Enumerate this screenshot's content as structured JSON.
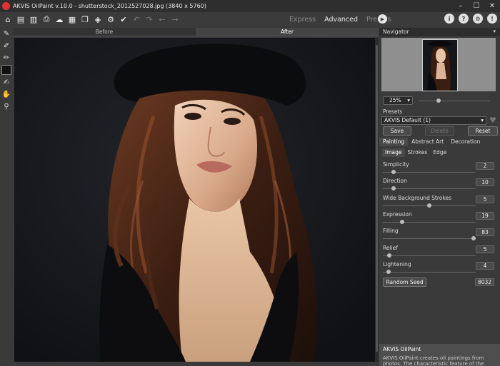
{
  "window": {
    "title": "AKVIS OilPaint v.10.0 - shutterstock_2012527028.jpg (3840 x 5760)",
    "controls": [
      "–",
      "☐",
      "✕"
    ]
  },
  "toolbar": {
    "modes": [
      "Express",
      "Advanced",
      "Presets"
    ],
    "active_mode": "Advanced"
  },
  "canvas_tabs": {
    "before": "Before",
    "after": "After"
  },
  "navigator": {
    "title": "Navigator",
    "zoom": "25%",
    "zoom_level": 0.25
  },
  "presets": {
    "title": "Presets",
    "selected": "AKVIS Default (1)",
    "save": "Save",
    "delete": "Delete",
    "reset": "Reset"
  },
  "tabs_main": [
    "Painting",
    "Abstract Art",
    "Decoration"
  ],
  "tabs_sub": [
    "Image",
    "Strokes",
    "Edge"
  ],
  "params": [
    {
      "label": "Simplicity",
      "value": "2",
      "fraction": 0.1
    },
    {
      "label": "Direction",
      "value": "10",
      "fraction": 0.1
    },
    {
      "label": "Wide Background Strokes",
      "value": "5",
      "fraction": 0.5
    },
    {
      "label": "Expression",
      "value": "19",
      "fraction": 0.19
    },
    {
      "label": "Filling",
      "value": "83",
      "fraction": 1.0
    },
    {
      "label": "Relief",
      "value": "5",
      "fraction": 0.05
    },
    {
      "label": "Lightening",
      "value": "4",
      "fraction": 0.04
    }
  ],
  "seed": {
    "button": "Random Seed",
    "value": "8032"
  },
  "help": {
    "title": "AKVIS OilPaint",
    "text": "AKVIS OilPaint creates oil paintings from photos. The characteristic feature of the program is a unique"
  },
  "colors": {
    "accent": "#d33333",
    "canvas_bg": "#16171a"
  },
  "icons": {
    "toolbar": [
      "home-icon",
      "open-icon",
      "save-icon",
      "print-icon",
      "share-icon",
      "batch-icon",
      "copy-icon",
      "plugin-icon",
      "preferences-icon",
      "apply-icon",
      "undo-icon",
      "redo-icon",
      "back-icon",
      "forward-icon"
    ],
    "tools": [
      "brush-icon",
      "color-picker-icon",
      "eraser-icon",
      "color-swatch",
      "history-brush-icon",
      "hand-icon",
      "zoom-icon"
    ],
    "right": [
      "info-icon",
      "help-icon",
      "settings-icon",
      "notifications-icon"
    ]
  }
}
